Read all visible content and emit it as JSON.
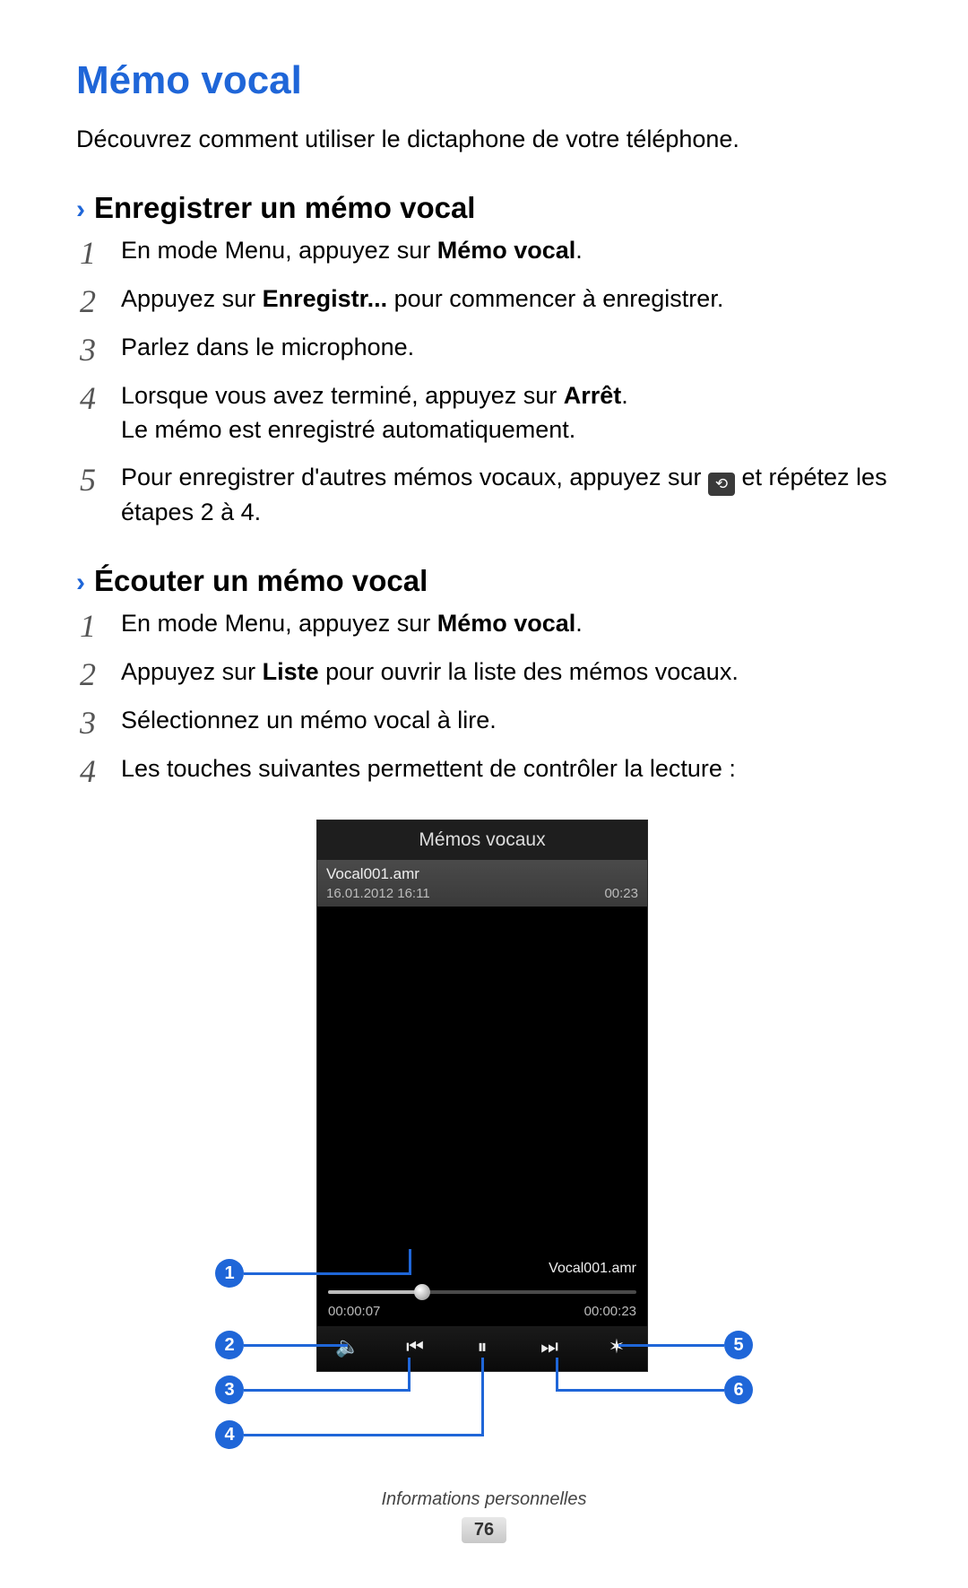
{
  "title": "Mémo vocal",
  "intro": "Découvrez comment utiliser le dictaphone de votre téléphone.",
  "section_record": {
    "heading": "Enregistrer un mémo vocal",
    "step1_a": "En mode Menu, appuyez sur ",
    "step1_b": "Mémo vocal",
    "step1_c": ".",
    "step2_a": "Appuyez sur ",
    "step2_b": "Enregistr...",
    "step2_c": " pour commencer à enregistrer.",
    "step3": "Parlez dans le microphone.",
    "step4_a": "Lorsque vous avez terminé, appuyez sur ",
    "step4_b": "Arrêt",
    "step4_c": ".",
    "step4_line2": "Le mémo est enregistré automatiquement.",
    "step5_a": "Pour enregistrer d'autres mémos vocaux, appuyez sur ",
    "step5_b": " et répétez les étapes 2 à 4."
  },
  "section_listen": {
    "heading": "Écouter un mémo vocal",
    "step1_a": "En mode Menu, appuyez sur ",
    "step1_b": "Mémo vocal",
    "step1_c": ".",
    "step2_a": "Appuyez sur ",
    "step2_b": "Liste",
    "step2_c": " pour ouvrir la liste des mémos vocaux.",
    "step3": "Sélectionnez un mémo vocal à lire.",
    "step4": "Les touches suivantes permettent de contrôler la lecture :"
  },
  "phone": {
    "header": "Mémos vocaux",
    "file_name": "Vocal001.amr",
    "file_date": "16.01.2012 16:11",
    "file_len": "00:23",
    "now_playing": "Vocal001.amr",
    "elapsed": "00:00:07",
    "total": "00:00:23"
  },
  "callouts": {
    "1": "1",
    "2": "2",
    "3": "3",
    "4": "4",
    "5": "5",
    "6": "6"
  },
  "footer": {
    "section": "Informations personnelles",
    "page": "76"
  },
  "icons": {
    "back": "⟲",
    "speaker": "🔈",
    "prev": "⏮",
    "pause": "⏸",
    "next": "⏭",
    "trim": "✶"
  }
}
